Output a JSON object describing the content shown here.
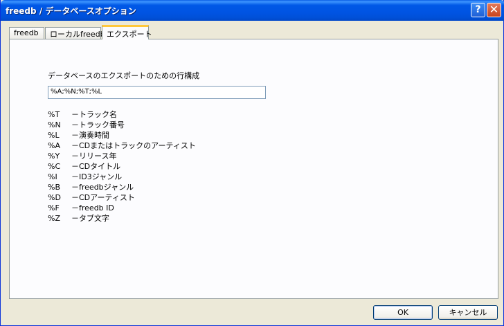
{
  "window": {
    "title": "freedb / データベースオプション"
  },
  "titlebar": {
    "help_label": "?",
    "close_label": "✕"
  },
  "tabs": [
    {
      "label": "freedb"
    },
    {
      "label": "ローカルfreedb"
    },
    {
      "label": "エクスポート"
    }
  ],
  "export": {
    "heading": "データベースのエクスポートのための行構成",
    "format_value": "%A;%N;%T;%L",
    "codes": [
      {
        "code": "%T",
        "desc": "－トラック名"
      },
      {
        "code": "%N",
        "desc": "－トラック番号"
      },
      {
        "code": "%L",
        "desc": "－演奏時間"
      },
      {
        "code": "%A",
        "desc": "－CDまたはトラックのアーティスト"
      },
      {
        "code": "%Y",
        "desc": "－リリース年"
      },
      {
        "code": "%C",
        "desc": "－CDタイトル"
      },
      {
        "code": "%I",
        "desc": "－ID3ジャンル"
      },
      {
        "code": "%B",
        "desc": "－freedbジャンル"
      },
      {
        "code": "%D",
        "desc": "－CDアーティスト"
      },
      {
        "code": "%F",
        "desc": "－freedb ID"
      },
      {
        "code": "%Z",
        "desc": "－タブ文字"
      }
    ]
  },
  "buttons": {
    "ok_label": "OK",
    "cancel_label": "キャンセル"
  }
}
